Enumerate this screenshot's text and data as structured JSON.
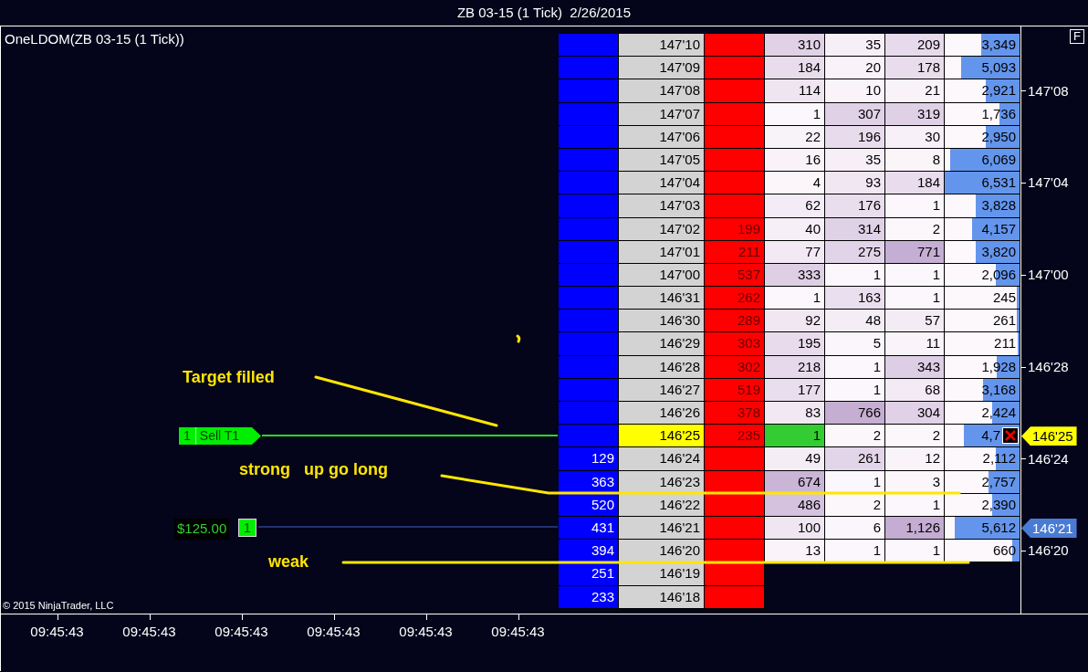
{
  "window": {
    "title": "ZB 03-15 (1 Tick)  2/26/2015"
  },
  "chart": {
    "title": "OneLDOM(ZB 03-15 (1 Tick))",
    "copyright": "© 2015 NinjaTrader, LLC",
    "float_button": "F"
  },
  "annotations": [
    {
      "text": "Target filled"
    },
    {
      "text": "strong   up go long"
    },
    {
      "text": "weak"
    }
  ],
  "orders": [
    {
      "kind": "target",
      "quantity": "1",
      "label": "Sell T1"
    },
    {
      "kind": "position",
      "pnl": "$125.00",
      "quantity": "1"
    }
  ],
  "ladder": [
    {
      "price": "147'10",
      "c4": "310",
      "c5": "35",
      "c6": "209",
      "volume": "3,349",
      "level": 0.51,
      "last_price": false
    },
    {
      "price": "147'09",
      "c4": "184",
      "c5": "20",
      "c6": "178",
      "volume": "5,093",
      "level": 0.78,
      "last_price": false
    },
    {
      "price": "147'08",
      "c4": "114",
      "c5": "10",
      "c6": "21",
      "volume": "2,921",
      "level": 0.45,
      "last_price": false,
      "tick": "147'08"
    },
    {
      "price": "147'07",
      "c4": "1",
      "c5": "307",
      "c6": "319",
      "volume": "1,736",
      "level": 0.27,
      "last_price": false
    },
    {
      "price": "147'06",
      "c4": "22",
      "c5": "196",
      "c6": "30",
      "volume": "2,950",
      "level": 0.45,
      "last_price": false
    },
    {
      "price": "147'05",
      "c4": "16",
      "c5": "35",
      "c6": "8",
      "volume": "6,069",
      "level": 0.93,
      "last_price": false
    },
    {
      "price": "147'04",
      "c4": "4",
      "c5": "93",
      "c6": "184",
      "volume": "6,531",
      "level": 1.0,
      "last_price": false,
      "tick": "147'04"
    },
    {
      "price": "147'03",
      "c4": "62",
      "c5": "176",
      "c6": "1",
      "volume": "3,828",
      "level": 0.59,
      "last_price": false
    },
    {
      "price": "147'02",
      "ask": "199",
      "c4": "40",
      "c5": "314",
      "c6": "2",
      "volume": "4,157",
      "level": 0.64,
      "last_price": false
    },
    {
      "price": "147'01",
      "ask": "211",
      "c4": "77",
      "c5": "275",
      "c6": "771",
      "volume": "3,820",
      "level": 0.58,
      "last_price": false
    },
    {
      "price": "147'00",
      "ask": "537",
      "c4": "333",
      "c5": "1",
      "c6": "1",
      "volume": "2,096",
      "level": 0.32,
      "last_price": false,
      "tick": "147'00"
    },
    {
      "price": "146'31",
      "ask": "262",
      "c4": "1",
      "c5": "163",
      "c6": "1",
      "volume": "245",
      "level": 0.04,
      "last_price": false
    },
    {
      "price": "146'30",
      "ask": "289",
      "c4": "92",
      "c5": "48",
      "c6": "57",
      "volume": "261",
      "level": 0.04,
      "last_price": false
    },
    {
      "price": "146'29",
      "ask": "303",
      "c4": "195",
      "c5": "5",
      "c6": "11",
      "volume": "211",
      "level": 0.03,
      "last_price": false
    },
    {
      "price": "146'28",
      "ask": "302",
      "c4": "218",
      "c5": "1",
      "c6": "343",
      "volume": "1,928",
      "level": 0.3,
      "last_price": false,
      "tick": "146'28"
    },
    {
      "price": "146'27",
      "ask": "519",
      "c4": "177",
      "c5": "1",
      "c6": "68",
      "volume": "3,168",
      "level": 0.49,
      "last_price": false
    },
    {
      "price": "146'26",
      "ask": "378",
      "c4": "83",
      "c5": "766",
      "c6": "304",
      "volume": "2,424",
      "level": 0.37,
      "last_price": false
    },
    {
      "price": "146'25",
      "ask": "235",
      "c4": "1",
      "c5": "2",
      "c6": "2",
      "volume": "4,7",
      "level": 0.74,
      "last_price": true,
      "order_cancel": true,
      "flag": {
        "kind": "last",
        "text": "146'25"
      }
    },
    {
      "bid": "129",
      "price": "146'24",
      "c4": "49",
      "c5": "261",
      "c6": "12",
      "volume": "2,112",
      "level": 0.32,
      "last_price": false,
      "tick": "146'24"
    },
    {
      "bid": "363",
      "price": "146'23",
      "c4": "674",
      "c5": "1",
      "c6": "3",
      "volume": "2,757",
      "level": 0.42,
      "last_price": false
    },
    {
      "bid": "520",
      "price": "146'22",
      "c4": "486",
      "c5": "2",
      "c6": "1",
      "volume": "2,390",
      "level": 0.37,
      "last_price": false
    },
    {
      "bid": "431",
      "price": "146'21",
      "c4": "100",
      "c5": "6",
      "c6": "1,126",
      "volume": "5,612",
      "level": 0.86,
      "last_price": false,
      "flag": {
        "kind": "order",
        "text": "146'21"
      }
    },
    {
      "bid": "394",
      "price": "146'20",
      "c4": "13",
      "c5": "1",
      "c6": "1",
      "volume": "660",
      "level": 0.1,
      "last_price": false,
      "tick": "146'20"
    },
    {
      "bid": "251",
      "price": "146'19",
      "last_price": false
    },
    {
      "bid": "233",
      "price": "146'18",
      "last_price": false
    }
  ],
  "time_axis": [
    "09:45:43",
    "09:45:43",
    "09:45:43",
    "09:45:43",
    "09:45:43",
    "09:45:43"
  ]
}
